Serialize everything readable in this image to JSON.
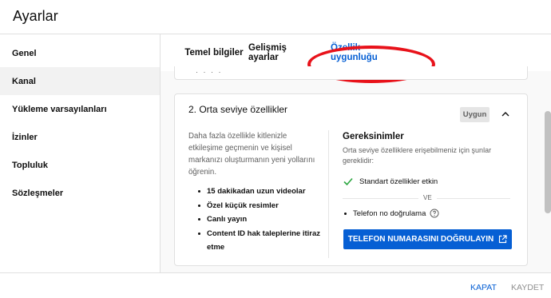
{
  "header": {
    "title": "Ayarlar"
  },
  "sidebar": {
    "items": [
      {
        "label": "Genel"
      },
      {
        "label": "Kanal"
      },
      {
        "label": "Yükleme varsayılanları"
      },
      {
        "label": "İzinler"
      },
      {
        "label": "Topluluk"
      },
      {
        "label": "Sözleşmeler"
      }
    ],
    "active": "Kanal"
  },
  "tabs": [
    {
      "label": "Temel bilgiler"
    },
    {
      "label": "Gelişmiş ayarlar"
    },
    {
      "label": "Özellik uygunluğu"
    }
  ],
  "active_tab": "Özellik uygunluğu",
  "card": {
    "title": "2. Orta seviye özellikler",
    "status_badge": "Uygun",
    "description": "Daha fazla özellikle kitlenizle etkileşime geçmenin ve kişisel markanızı oluşturmanın yeni yollarını öğrenin.",
    "features": [
      "15 dakikadan uzun videolar",
      "Özel küçük resimler",
      "Canlı yayın",
      "Content ID hak taleplerine itiraz etme"
    ],
    "requirements": {
      "title": "Gereksinimler",
      "description": "Orta seviye özelliklere erişebilmeniz için şunlar gereklidir:",
      "met": "Standart özellikler etkin",
      "or_label": "VE",
      "pending": "Telefon no doğrulama",
      "verify_button": "TELEFON NUMARASINI DOĞRULAYIN"
    }
  },
  "footer": {
    "close_label": "KAPAT",
    "save_label": "KAYDET"
  },
  "colors": {
    "accent": "#065fd4",
    "annotation": "#e8121a",
    "check": "#2ba640"
  }
}
